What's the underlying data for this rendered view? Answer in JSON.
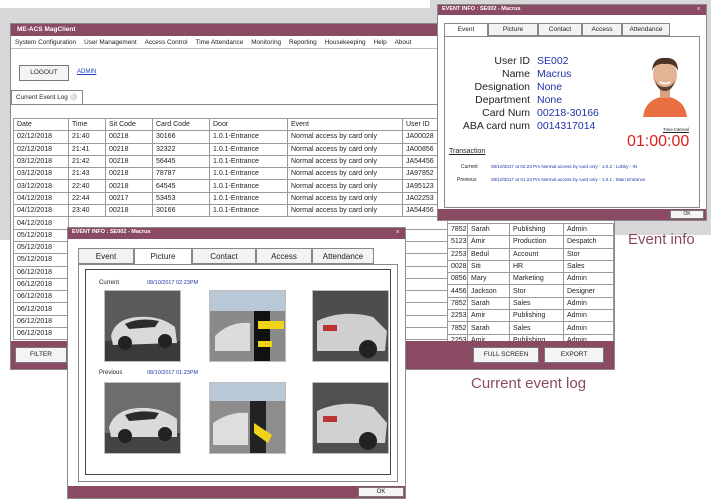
{
  "main_window": {
    "title": "ME-ACS MagClient",
    "menu": [
      "System Configuration",
      "User Management",
      "Access Control",
      "Time Attendance",
      "Monitoring",
      "Reporting",
      "Housekeeping",
      "Help",
      "About"
    ],
    "logout_label": "LOGOUT",
    "admin_link": "ADMIN",
    "tab_label": "Current Event Log",
    "columns": [
      "Date",
      "Time",
      "Sit Code",
      "Card Code",
      "Door",
      "Event",
      "User ID"
    ],
    "rows": [
      [
        "02/12/2018",
        "21:40",
        "00218",
        "30166",
        "1.0.1-Entrance",
        "Normal access by card only",
        "JA00028"
      ],
      [
        "02/12/2018",
        "21:41",
        "00218",
        "32322",
        "1.0.1-Entrance",
        "Normal access by card only",
        "JA00856"
      ],
      [
        "03/12/2018",
        "21:42",
        "00218",
        "56445",
        "1.0.1-Entrance",
        "Normal access by card only",
        "JA54456"
      ],
      [
        "03/12/2018",
        "21:43",
        "00218",
        "78787",
        "1.0.1-Entrance",
        "Normal access by card only",
        "JA97852"
      ],
      [
        "03/12/2018",
        "22:40",
        "00218",
        "64545",
        "1.0.1-Entrance",
        "Normal access by card only",
        "JA95123"
      ],
      [
        "04/12/2018",
        "22:44",
        "00217",
        "53453",
        "1.0.1-Entrance",
        "Normal access by card only",
        "JA02253"
      ],
      [
        "04/12/2018",
        "23:40",
        "00218",
        "30166",
        "1.0.1-Entrance",
        "Normal access by card only",
        "JA54456"
      ]
    ],
    "hidden_rows_dates": [
      "04/12/2018",
      "05/12/2018",
      "05/12/2018",
      "05/12/2018",
      "06/12/2018",
      "06/12/2018",
      "06/12/2018",
      "06/12/2018",
      "06/12/2018",
      "06/12/2018"
    ],
    "right_rows": [
      [
        "7852",
        "Sarah",
        "Publishing",
        "Admin"
      ],
      [
        "5123",
        "Amir",
        "Production",
        "Despatch"
      ],
      [
        "2253",
        "Bedul",
        "Account",
        "Stor"
      ],
      [
        "0028",
        "Siti",
        "HR",
        "Sales"
      ],
      [
        "0856",
        "Mary",
        "Marketing",
        "Admin"
      ],
      [
        "4456",
        "Jackson",
        "Stor",
        "Designer"
      ],
      [
        "7852",
        "Sarah",
        "Sales",
        "Admin"
      ],
      [
        "2253",
        "Amir",
        "Publishing",
        "Admin"
      ],
      [
        "7852",
        "Sarah",
        "Sales",
        "Admin"
      ],
      [
        "2253",
        "Amir",
        "Publishing",
        "Admin"
      ]
    ],
    "filter_label": "FILTER",
    "fullscreen_label": "FULL SCREEN",
    "export_label": "EXPORT"
  },
  "info_window": {
    "title": "EVENT INFO : SE002 - Macrus",
    "close": "x",
    "tabs": [
      "Event",
      "Picture",
      "Contact",
      "Access",
      "Attendance"
    ],
    "fields": [
      {
        "label": "User ID",
        "value": "SE002"
      },
      {
        "label": "Name",
        "value": "Macrus"
      },
      {
        "label": "Designation",
        "value": "None"
      },
      {
        "label": "Department",
        "value": "None"
      },
      {
        "label": "Card Num",
        "value": "00218-30166"
      },
      {
        "label": "ABA card num",
        "value": "0014317014"
      }
    ],
    "time_interval_label": "Time Interval",
    "time_interval_value": "01:00:00",
    "transaction_label": "Transaction",
    "current_label": "Current",
    "current_text": "08/10/2017 at 02:23 Pm Normal access by card only - 1.0.2 : Lobby - IN",
    "previous_label": "Previous",
    "previous_text": "08/10/2017 at 01:23 Pm Normal access by card only - 1.0.1 : Main Entrance",
    "ok_label": "OK"
  },
  "picture_window": {
    "title": "EVENT INFO : SE002 - Macrus",
    "close": "x",
    "tabs": [
      "Event",
      "Picture",
      "Contact",
      "Access",
      "Attendance"
    ],
    "current_label": "Current",
    "current_time": "08/10/2017 02:23PM",
    "previous_label": "Previous",
    "previous_time": "08/10/2017 01:23PM",
    "ok_label": "OK"
  },
  "captions": {
    "event_info": "Event info",
    "current_event_log": "Current event log"
  },
  "colors": {
    "accent": "#8b4a63",
    "value_blue": "#2033a8",
    "timer_red": "#e0201c"
  }
}
